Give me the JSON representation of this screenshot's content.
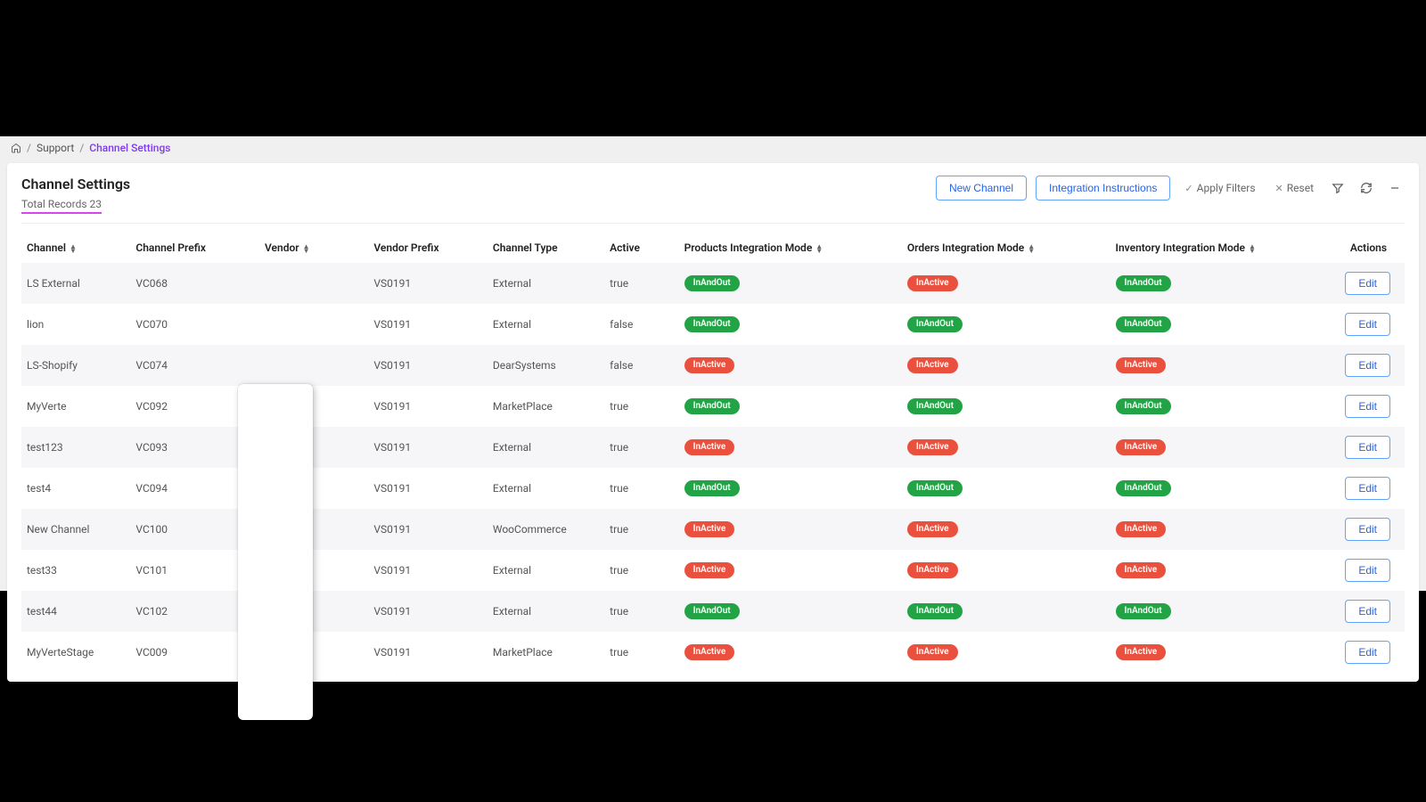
{
  "breadcrumb": {
    "support": "Support",
    "current": "Channel Settings"
  },
  "header": {
    "title": "Channel Settings",
    "subtitle": "Total Records 23",
    "new_channel": "New Channel",
    "integration_instructions": "Integration Instructions",
    "apply_filters": "Apply Filters",
    "reset": "Reset"
  },
  "columns": {
    "channel": "Channel",
    "channel_prefix": "Channel Prefix",
    "vendor": "Vendor",
    "vendor_prefix": "Vendor Prefix",
    "channel_type": "Channel Type",
    "active": "Active",
    "products_mode": "Products Integration Mode",
    "orders_mode": "Orders Integration Mode",
    "inventory_mode": "Inventory Integration Mode",
    "actions": "Actions"
  },
  "badges": {
    "InAndOut": {
      "label": "InAndOut",
      "color": "green"
    },
    "InActive": {
      "label": "InActive",
      "color": "red"
    }
  },
  "edit_label": "Edit",
  "rows": [
    {
      "channel": "LS External",
      "prefix": "VC068",
      "vendor": "",
      "vprefix": "VS0191",
      "ctype": "External",
      "active": "true",
      "pim": "InAndOut",
      "oim": "InActive",
      "iim": "InAndOut"
    },
    {
      "channel": "lion",
      "prefix": "VC070",
      "vendor": "",
      "vprefix": "VS0191",
      "ctype": "External",
      "active": "false",
      "pim": "InAndOut",
      "oim": "InAndOut",
      "iim": "InAndOut"
    },
    {
      "channel": "LS-Shopify",
      "prefix": "VC074",
      "vendor": "",
      "vprefix": "VS0191",
      "ctype": "DearSystems",
      "active": "false",
      "pim": "InActive",
      "oim": "InActive",
      "iim": "InActive"
    },
    {
      "channel": "MyVerte",
      "prefix": "VC092",
      "vendor": "",
      "vprefix": "VS0191",
      "ctype": "MarketPlace",
      "active": "true",
      "pim": "InAndOut",
      "oim": "InAndOut",
      "iim": "InAndOut"
    },
    {
      "channel": "test123",
      "prefix": "VC093",
      "vendor": "",
      "vprefix": "VS0191",
      "ctype": "External",
      "active": "true",
      "pim": "InActive",
      "oim": "InActive",
      "iim": "InActive"
    },
    {
      "channel": "test4",
      "prefix": "VC094",
      "vendor": "",
      "vprefix": "VS0191",
      "ctype": "External",
      "active": "true",
      "pim": "InAndOut",
      "oim": "InAndOut",
      "iim": "InAndOut"
    },
    {
      "channel": "New Channel",
      "prefix": "VC100",
      "vendor": "",
      "vprefix": "VS0191",
      "ctype": "WooCommerce",
      "active": "true",
      "pim": "InActive",
      "oim": "InActive",
      "iim": "InActive"
    },
    {
      "channel": "test33",
      "prefix": "VC101",
      "vendor": "",
      "vprefix": "VS0191",
      "ctype": "External",
      "active": "true",
      "pim": "InActive",
      "oim": "InActive",
      "iim": "InActive"
    },
    {
      "channel": "test44",
      "prefix": "VC102",
      "vendor": "",
      "vprefix": "VS0191",
      "ctype": "External",
      "active": "true",
      "pim": "InAndOut",
      "oim": "InAndOut",
      "iim": "InAndOut"
    },
    {
      "channel": "MyVerteStage",
      "prefix": "VC009",
      "vendor": "",
      "vprefix": "VS0191",
      "ctype": "MarketPlace",
      "active": "true",
      "pim": "InActive",
      "oim": "InActive",
      "iim": "InActive"
    }
  ]
}
